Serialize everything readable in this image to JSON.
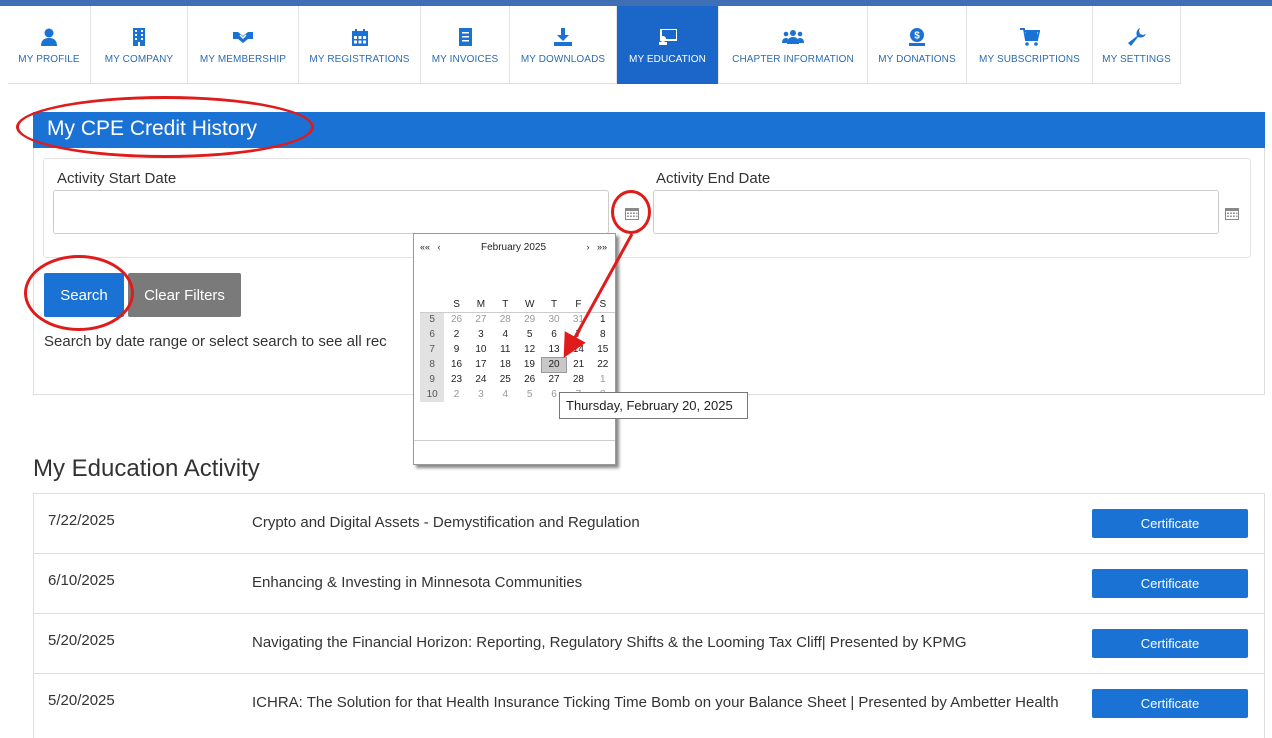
{
  "nav": {
    "items": [
      {
        "label": "MY PROFILE",
        "icon": "user-icon"
      },
      {
        "label": "MY COMPANY",
        "icon": "building-icon"
      },
      {
        "label": "MY MEMBERSHIP",
        "icon": "handshake-icon"
      },
      {
        "label": "MY REGISTRATIONS",
        "icon": "calendar-icon"
      },
      {
        "label": "MY INVOICES",
        "icon": "invoice-icon"
      },
      {
        "label": "MY DOWNLOADS",
        "icon": "download-icon"
      },
      {
        "label": "MY EDUCATION",
        "icon": "education-icon",
        "active": true
      },
      {
        "label": "CHAPTER INFORMATION",
        "icon": "users-icon"
      },
      {
        "label": "MY DONATIONS",
        "icon": "donation-icon"
      },
      {
        "label": "MY SUBSCRIPTIONS",
        "icon": "cart-icon"
      },
      {
        "label": "MY SETTINGS",
        "icon": "wrench-icon"
      }
    ]
  },
  "credit_history": {
    "title": "My CPE Credit History",
    "start_label": "Activity Start Date",
    "start_value": "",
    "end_label": "Activity End Date",
    "end_value": "",
    "search_label": "Search",
    "clear_label": "Clear Filters",
    "hint": "Search by date range or select search to see all rec"
  },
  "datepicker": {
    "month_label": "February 2025",
    "prev_year": "««",
    "prev_month": "‹",
    "next_month": "›",
    "next_year": "»»",
    "weekdays": [
      "S",
      "M",
      "T",
      "W",
      "T",
      "F",
      "S"
    ],
    "weeks": [
      {
        "num": "5",
        "days": [
          "26",
          "27",
          "28",
          "29",
          "30",
          "31",
          "1"
        ]
      },
      {
        "num": "6",
        "days": [
          "2",
          "3",
          "4",
          "5",
          "6",
          "7",
          "8"
        ]
      },
      {
        "num": "7",
        "days": [
          "9",
          "10",
          "11",
          "12",
          "13",
          "14",
          "15"
        ]
      },
      {
        "num": "8",
        "days": [
          "16",
          "17",
          "18",
          "19",
          "20",
          "21",
          "22"
        ]
      },
      {
        "num": "9",
        "days": [
          "23",
          "24",
          "25",
          "26",
          "27",
          "28",
          "1"
        ]
      },
      {
        "num": "10",
        "days": [
          "2",
          "3",
          "4",
          "5",
          "6",
          "7",
          "8"
        ]
      }
    ],
    "selected_day": "20",
    "tooltip": "Thursday, February 20, 2025"
  },
  "activity": {
    "title": "My Education Activity",
    "certificate_label": "Certificate",
    "rows": [
      {
        "date": "7/22/2025",
        "title": "Crypto and Digital Assets - Demystification and Regulation"
      },
      {
        "date": "6/10/2025",
        "title": "Enhancing & Investing in Minnesota Communities"
      },
      {
        "date": "5/20/2025",
        "title": "Navigating the Financial Horizon: Reporting, Regulatory Shifts & the Looming Tax Cliff| Presented by KPMG"
      },
      {
        "date": "5/20/2025",
        "title": "ICHRA: The Solution for that Health Insurance Ticking Time Bomb on your Balance Sheet | Presented by Ambetter Health"
      }
    ]
  },
  "colors": {
    "accent": "#1a73d4",
    "active_tab": "#1a66c9",
    "annotation": "#e01b1b",
    "clear_button": "#7a7a7a"
  }
}
